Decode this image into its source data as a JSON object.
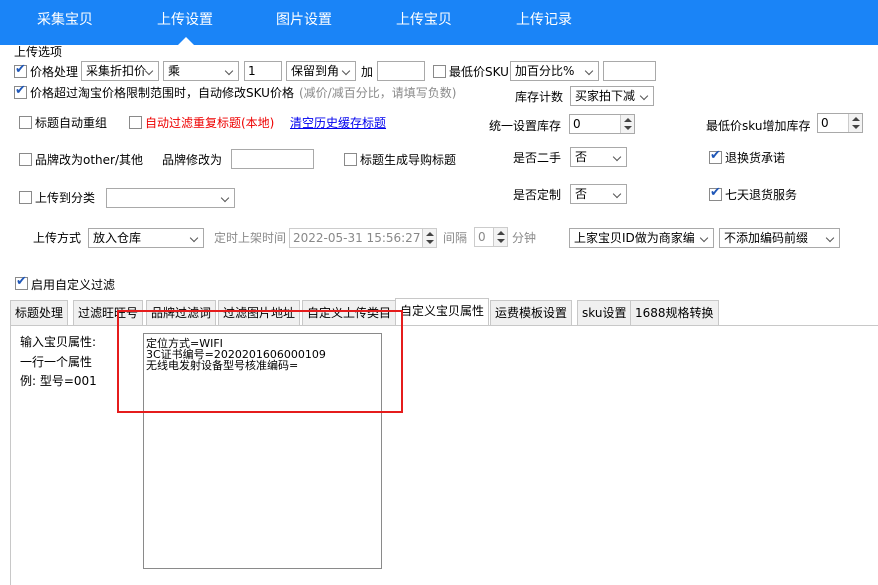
{
  "nav": {
    "items": [
      "采集宝贝",
      "上传设置",
      "图片设置",
      "上传宝贝",
      "上传记录"
    ],
    "active": "上传设置"
  },
  "upload_options": {
    "group_title": "上传选项",
    "price_process": {
      "label": "价格处理",
      "checked": true,
      "mode": "采集折扣价",
      "operator": "乘",
      "factor": "1",
      "rounding": "保留到角",
      "add_label": "加",
      "add_value": ""
    },
    "min_price_sku": {
      "label": "最低价SKU",
      "checked": false,
      "mode": "加百分比%",
      "value": ""
    },
    "auto_fix_price": {
      "label": "价格超过淘宝价格限制范围时，自动修改SKU价格",
      "checked": true,
      "hint": "(减价/减百分比，请填写负数)"
    },
    "stock_count": {
      "label": "库存计数",
      "value": "买家拍下减"
    },
    "title_regroup": {
      "label": "标题自动重组",
      "checked": false
    },
    "auto_filter_dup": {
      "label": "自动过滤重复标题(本地)",
      "checked": false
    },
    "clear_cache_link": "清空历史缓存标题",
    "unified_stock": {
      "label": "统一设置库存",
      "value": "0"
    },
    "min_sku_add_stock": {
      "label": "最低价sku增加库存",
      "value": "0"
    },
    "brand_other": {
      "label": "品牌改为other/其他",
      "checked": false
    },
    "brand_change": {
      "label": "品牌修改为",
      "value": ""
    },
    "title_gen_shopping": {
      "label": "标题生成导购标题",
      "checked": false
    },
    "second_hand": {
      "label": "是否二手",
      "value": "否"
    },
    "return_commit": {
      "label": "退换货承诺",
      "checked": true
    },
    "upload_category": {
      "label": "上传到分类",
      "checked": false,
      "value": ""
    },
    "custom_made": {
      "label": "是否定制",
      "value": "否"
    },
    "seven_day_return": {
      "label": "七天退货服务",
      "checked": true
    },
    "upload_mode": {
      "label": "上传方式",
      "value": "放入仓库"
    },
    "scheduled_time": {
      "label": "定时上架时间",
      "value": "2022-05-31 15:56:27"
    },
    "interval": {
      "label": "间隔",
      "value": "0",
      "unit": "分钟"
    },
    "merchant_code_mode": "上家宝贝ID做为商家编",
    "code_prefix": "不添加编码前缀"
  },
  "custom_filter": {
    "label": "启用自定义过滤",
    "checked": true
  },
  "tabs": [
    "标题处理",
    "过滤旺旺号",
    "品牌过滤词",
    "过滤图片地址",
    "自定义上传类目",
    "自定义宝贝属性",
    "运费模板设置",
    "sku设置",
    "1688规格转换"
  ],
  "active_tab": "自定义宝贝属性",
  "attr_panel": {
    "help_lines": [
      "输入宝贝属性:",
      "一行一个属性",
      "例: 型号=001"
    ],
    "textarea_value": "定位方式=WIFI\n3C证书编号=2020201606000109\n无线电发射设备型号核准编码="
  },
  "colors": {
    "nav_bg": "#1a84f7",
    "highlight_box": "#e51c1c"
  }
}
